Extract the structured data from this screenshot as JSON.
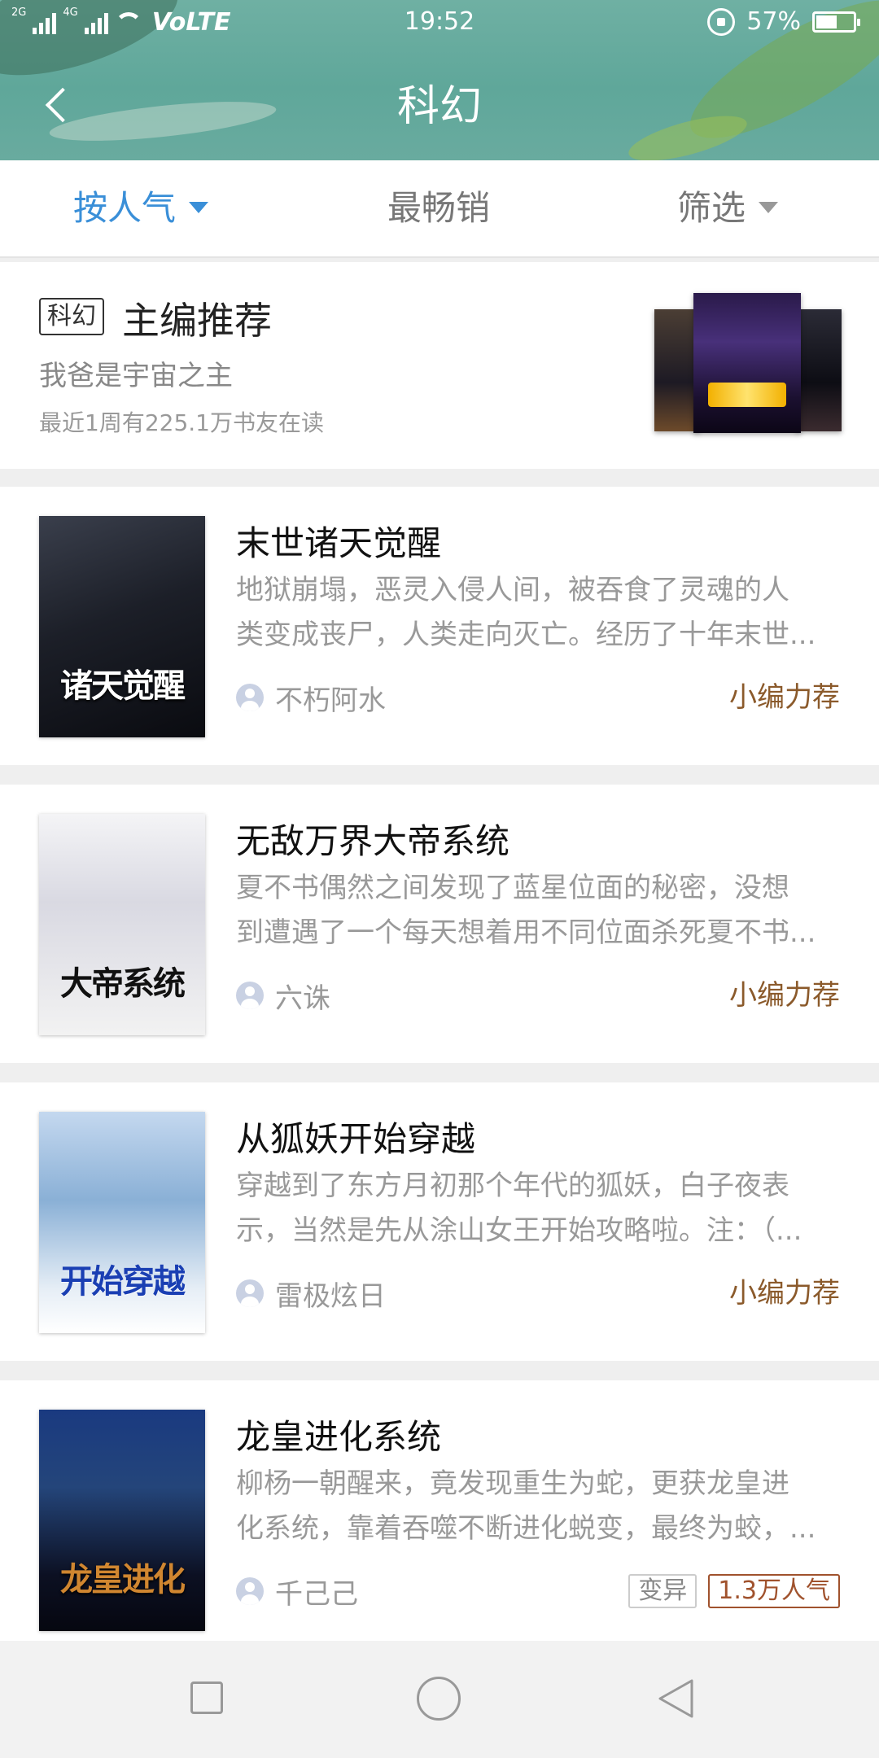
{
  "status_bar": {
    "network": "2G",
    "network2": "4G",
    "carrier": "VoLTE",
    "time": "19:52",
    "battery": "57%",
    "battery_level": 0.57
  },
  "header": {
    "title": "科幻"
  },
  "tabs": [
    {
      "label": "按人气",
      "active": true
    },
    {
      "label": "最畅销",
      "active": false
    },
    {
      "label": "筛选",
      "active": false
    }
  ],
  "recommend": {
    "badge": "科幻",
    "title": "主编推荐",
    "book": "我爸是宇宙之主",
    "readers": "最近1周有225.1万书友在读"
  },
  "books": [
    {
      "title": "末世诸天觉醒",
      "cover_text": "诸天觉醒",
      "desc_line1": "地狱崩塌，恶灵入侵人间，被吞食了灵魂的人",
      "desc_line2": "类变成丧尸，人类走向灭亡。经历了十年末世...",
      "author": "不朽阿水",
      "tag": "小编力荐"
    },
    {
      "title": "无敌万界大帝系统",
      "cover_text": "大帝系统",
      "desc_line1": "夏不书偶然之间发现了蓝星位面的秘密，没想",
      "desc_line2": "到遭遇了一个每天想着用不同位面杀死夏不书...",
      "author": "六诛",
      "tag": "小编力荐"
    },
    {
      "title": "从狐妖开始穿越",
      "cover_text": "开始穿越",
      "desc_line1": "穿越到了东方月初那个年代的狐妖，白子夜表",
      "desc_line2": "示，当然是先从涂山女王开始攻略啦。注：（...",
      "author": "雷极炫日",
      "tag": "小编力荐"
    },
    {
      "title": "龙皇进化系统",
      "cover_text": "龙皇进化",
      "desc_line1": "柳杨一朝醒来，竟发现重生为蛇，更获龙皇进",
      "desc_line2": "化系统，靠着吞噬不断进化蜕变，最终为蛟，...",
      "author": "千己己",
      "tag1": "变异",
      "tag2": "1.3万人气"
    }
  ],
  "colors": {
    "accent": "#3a8fd8",
    "header_bg": "#5fa79a",
    "recommend_tag": "#8b5a2b"
  }
}
